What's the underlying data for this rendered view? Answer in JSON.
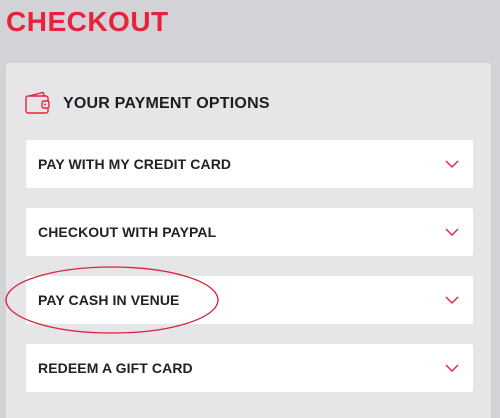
{
  "page": {
    "title": "CHECKOUT"
  },
  "payment_panel": {
    "title": "YOUR PAYMENT OPTIONS",
    "icon": "wallet-icon",
    "options": [
      {
        "label": "PAY WITH MY CREDIT CARD",
        "icon": "chevron-down-icon"
      },
      {
        "label": "CHECKOUT WITH PAYPAL",
        "icon": "chevron-down-icon"
      },
      {
        "label": "PAY CASH IN VENUE",
        "icon": "chevron-down-icon"
      },
      {
        "label": "REDEEM A GIFT CARD",
        "icon": "chevron-down-icon"
      }
    ]
  },
  "colors": {
    "accent": "#e8213d",
    "background": "#d3d2d6",
    "panel": "#e6e6e8",
    "option_bg": "#ffffff",
    "text": "#222222"
  }
}
